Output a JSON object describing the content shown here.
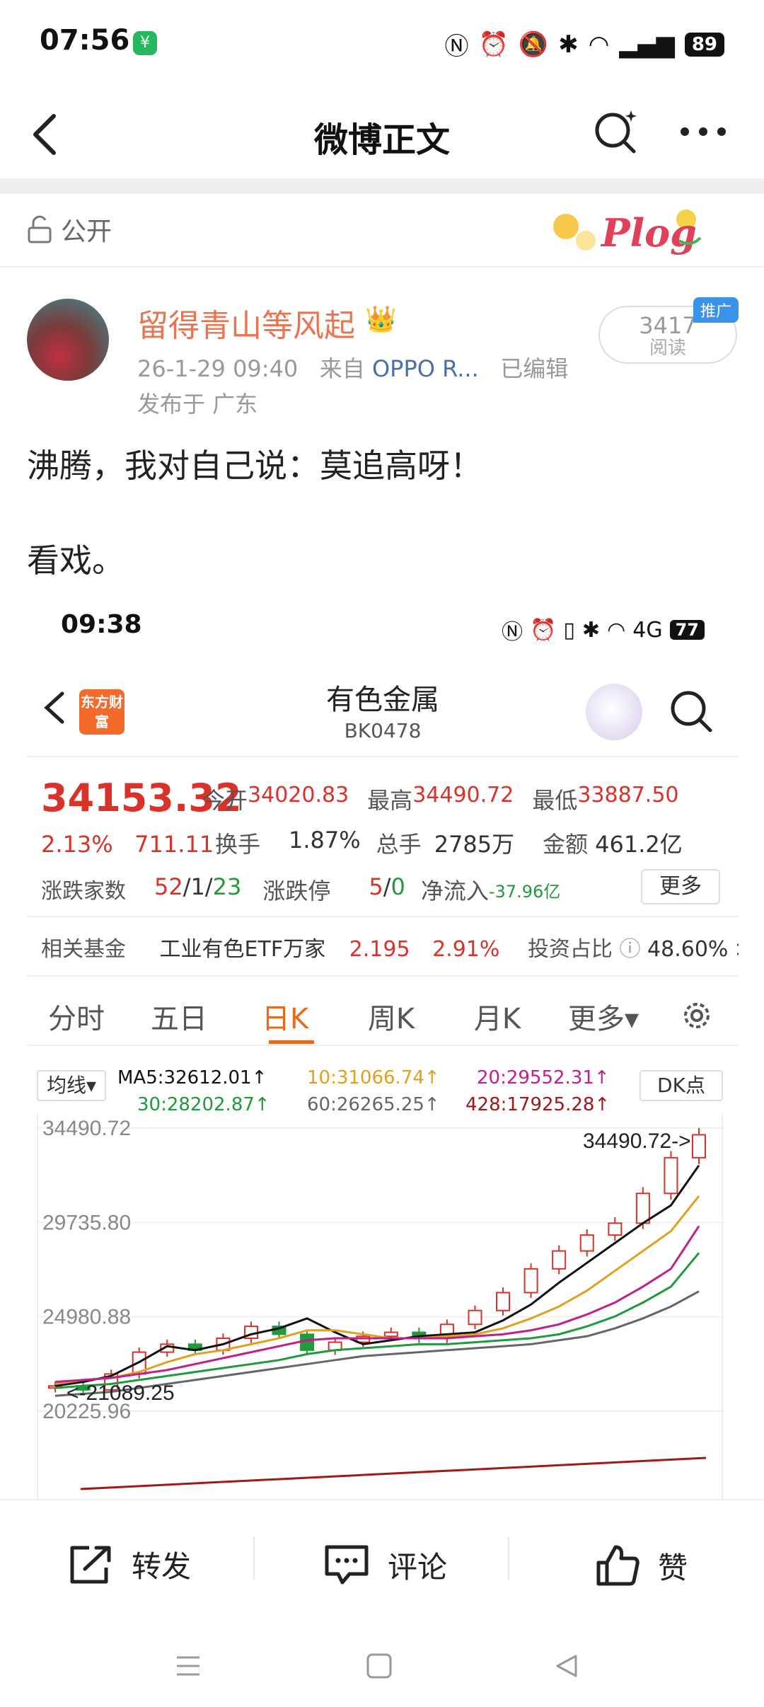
{
  "status_bar": {
    "time": "07:56",
    "app_icon": "wechat-pay-icon",
    "icons": [
      "nfc-icon",
      "alarm-icon",
      "mute-icon",
      "bluetooth-icon",
      "wifi-icon",
      "signal-5g-icon"
    ],
    "battery": "89"
  },
  "nav": {
    "title": "微博正文",
    "back_icon": "chevron-left-icon",
    "search_icon": "search-sparkle-icon",
    "more_icon": "more-dots-icon"
  },
  "visibility": {
    "label": "公开",
    "icon": "unlock-icon",
    "badge_text": "Plog"
  },
  "author": {
    "name": "留得青山等风起",
    "badge_icon": "crown-icon",
    "time": "26-1-29 09:40",
    "from_prefix": "来自",
    "source": "OPPO R...",
    "edited": "已编辑",
    "location": "发布于 广东",
    "read_count": "3417",
    "read_label": "阅读",
    "promo_tag": "推广"
  },
  "post": {
    "line1": "沸腾，我对自己说：莫追高呀！",
    "line2": "看戏。"
  },
  "embed": {
    "status": {
      "time": "09:38",
      "battery": "77",
      "network": "4G"
    },
    "header": {
      "logo_text": "东方财富",
      "title": "有色金属",
      "code": "BK0478"
    },
    "quote": {
      "price": "34153.32",
      "change_pct": "2.13%",
      "change_abs": "711.11",
      "open_label": "今开",
      "open": "34020.83",
      "high_label": "最高",
      "high": "34490.72",
      "low_label": "最低",
      "low": "33887.50",
      "turnover_label": "换手",
      "turnover": "1.87%",
      "volume_label": "总手",
      "volume": "2785万",
      "amount_label": "金额",
      "amount": "461.2亿",
      "breadth_label": "涨跌家数",
      "up": "52",
      "flat": "1",
      "down": "23",
      "limit_label": "涨跌停",
      "limit_up": "5",
      "limit_down": "0",
      "netflow_label": "净流入",
      "netflow": "-37.96亿",
      "more_label": "更多"
    },
    "fund": {
      "label": "相关基金",
      "name": "工业有色ETF万家",
      "price": "2.195",
      "pct": "2.91%",
      "ratio_label": "投资占比",
      "ratio": "48.60% >"
    },
    "tabs": [
      "分时",
      "五日",
      "日K",
      "周K",
      "月K",
      "更多▾"
    ],
    "active_tab": "日K",
    "ma": {
      "btn": "均线▾",
      "ma5": "MA5:32612.01↑",
      "ma10": "10:31066.74↑",
      "ma20": "20:29552.31↑",
      "ma30": "30:28202.87↑",
      "ma60": "60:26265.25↑",
      "ma428": "428:17925.28↑",
      "dk_btn": "DK点"
    },
    "colors": {
      "up": "#d8322a",
      "down": "#1f9a3c",
      "ma5": "#111111",
      "ma10": "#e0a020",
      "ma20": "#c0208a",
      "ma30": "#1f9a3c",
      "ma60": "#666666",
      "ma428": "#a01818"
    }
  },
  "chart_data": {
    "type": "candlestick",
    "title": "",
    "y_ticks": [
      "34490.72",
      "29735.80",
      "24980.88",
      "20225.96"
    ],
    "ylim": [
      20225.96,
      34490.72
    ],
    "annotations": {
      "high": "34490.72->",
      "low": "<-21089.25"
    },
    "series": [
      {
        "name": "MA5",
        "values": [
          21500,
          21700,
          22000,
          22700,
          23500,
          23300,
          23600,
          24100,
          24400,
          24900,
          24200,
          23600,
          23800,
          24000,
          24100,
          24200,
          24800,
          25600,
          26700,
          27700,
          28700,
          29700,
          30600,
          32612.01
        ]
      },
      {
        "name": "10",
        "values": [
          21600,
          21800,
          21900,
          22200,
          22700,
          23100,
          23300,
          23600,
          23900,
          24300,
          24300,
          24100,
          23900,
          23900,
          24000,
          24100,
          24400,
          24900,
          25500,
          26300,
          27300,
          28300,
          29300,
          31066.74
        ]
      },
      {
        "name": "20",
        "values": [
          21700,
          21800,
          21900,
          22100,
          22300,
          22600,
          22900,
          23200,
          23500,
          23800,
          23900,
          23900,
          23900,
          23900,
          23900,
          24000,
          24100,
          24300,
          24600,
          25100,
          25700,
          26500,
          27400,
          29552.31
        ]
      },
      {
        "name": "30",
        "values": [
          21400,
          21500,
          21600,
          21800,
          22000,
          22200,
          22400,
          22600,
          22800,
          23100,
          23300,
          23400,
          23500,
          23600,
          23600,
          23700,
          23800,
          23900,
          24100,
          24500,
          25000,
          25700,
          26500,
          28202.87
        ]
      },
      {
        "name": "60",
        "values": [
          21000,
          21100,
          21200,
          21400,
          21600,
          21800,
          22000,
          22200,
          22400,
          22600,
          22800,
          23000,
          23100,
          23200,
          23300,
          23400,
          23500,
          23600,
          23800,
          24000,
          24400,
          24900,
          25500,
          26265.25
        ]
      }
    ],
    "candles": [
      21500,
      21300,
      22100,
      23200,
      23600,
      23300,
      23900,
      24500,
      24100,
      23300,
      23700,
      24000,
      24200,
      23900,
      24600,
      25300,
      26200,
      27400,
      28300,
      29100,
      29700,
      31200,
      33000,
      34153.32
    ]
  },
  "actions": {
    "repost": "转发",
    "comment": "评论",
    "like": "赞"
  }
}
